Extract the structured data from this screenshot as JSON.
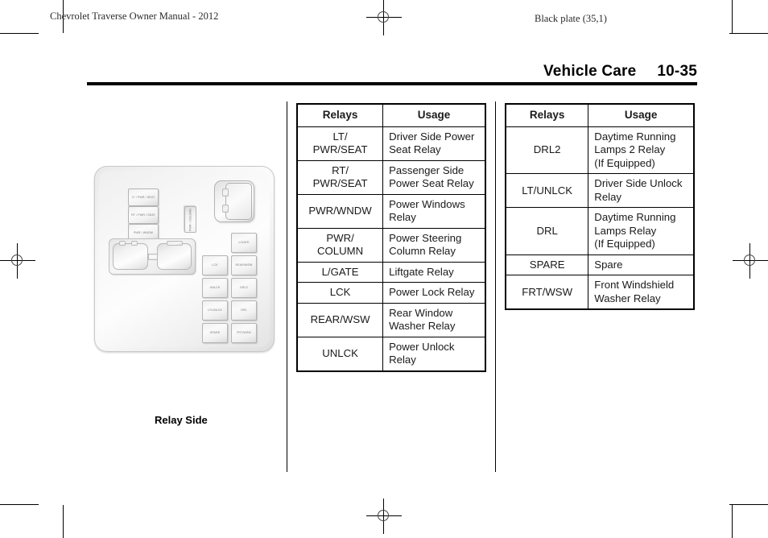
{
  "running_head": {
    "manual_title": "Chevrolet Traverse Owner Manual - 2012",
    "black_plate": "Black plate (35,1)"
  },
  "page_header": {
    "chapter": "Vehicle Care",
    "page_number": "10-35"
  },
  "figure": {
    "caption": "Relay Side",
    "relay_labels": {
      "lt_pwr_seat": "LT / PWR\n/ SEAT",
      "rt_pwr_seat": "RT / PWR\n/ SEAT",
      "pwr_wndw": "PWR /\nWNDW",
      "pwr_column": "PWR /\nCOLUMN",
      "l_gate": "L/GATE",
      "lck": "LCK",
      "rear_wsw": "REAR/WSW",
      "unlck": "UNLCK",
      "drl2": "DRL2",
      "lt_unlck": "LT/UNLCK",
      "drl": "DRL",
      "spare": "SPARE",
      "frt_wsw": "FRT/WSW"
    }
  },
  "table_left": {
    "headers": [
      "Relays",
      "Usage"
    ],
    "rows": [
      {
        "relay": "LT/\nPWR/SEAT",
        "usage": "Driver Side Power\nSeat Relay"
      },
      {
        "relay": "RT/\nPWR/SEAT",
        "usage": "Passenger Side\nPower Seat Relay"
      },
      {
        "relay": "PWR/WNDW",
        "usage": "Power Windows\nRelay"
      },
      {
        "relay": "PWR/\nCOLUMN",
        "usage": "Power Steering\nColumn Relay"
      },
      {
        "relay": "L/GATE",
        "usage": "Liftgate Relay"
      },
      {
        "relay": "LCK",
        "usage": "Power Lock Relay"
      },
      {
        "relay": "REAR/WSW",
        "usage": "Rear Window\nWasher Relay"
      },
      {
        "relay": "UNLCK",
        "usage": "Power Unlock\nRelay"
      }
    ]
  },
  "table_right": {
    "headers": [
      "Relays",
      "Usage"
    ],
    "rows": [
      {
        "relay": "DRL2",
        "usage": "Daytime Running\nLamps 2 Relay\n(If Equipped)"
      },
      {
        "relay": "LT/UNLCK",
        "usage": "Driver Side Unlock\nRelay"
      },
      {
        "relay": "DRL",
        "usage": "Daytime Running\nLamps Relay\n(If Equipped)"
      },
      {
        "relay": "SPARE",
        "usage": "Spare"
      },
      {
        "relay": "FRT/WSW",
        "usage": "Front Windshield\nWasher Relay"
      }
    ]
  }
}
